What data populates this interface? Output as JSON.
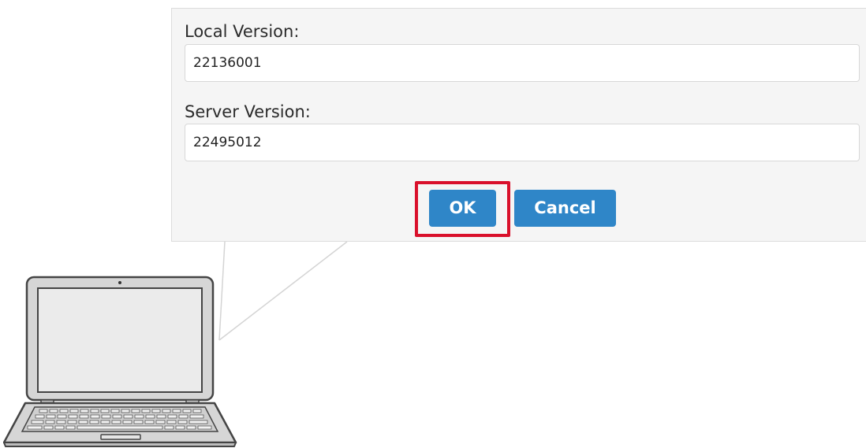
{
  "dialog": {
    "local_version_label": "Local Version:",
    "local_version_value": "22136001",
    "server_version_label": "Server Version:",
    "server_version_value": "22495012",
    "ok_label": "OK",
    "cancel_label": "Cancel"
  },
  "colors": {
    "button_background": "#2f86c8",
    "highlight_border": "#d9102b",
    "dialog_background": "#f5f5f5",
    "laptop_body": "#d6d6d6",
    "laptop_outline": "#444444"
  },
  "icons": {
    "device": "laptop-icon"
  }
}
